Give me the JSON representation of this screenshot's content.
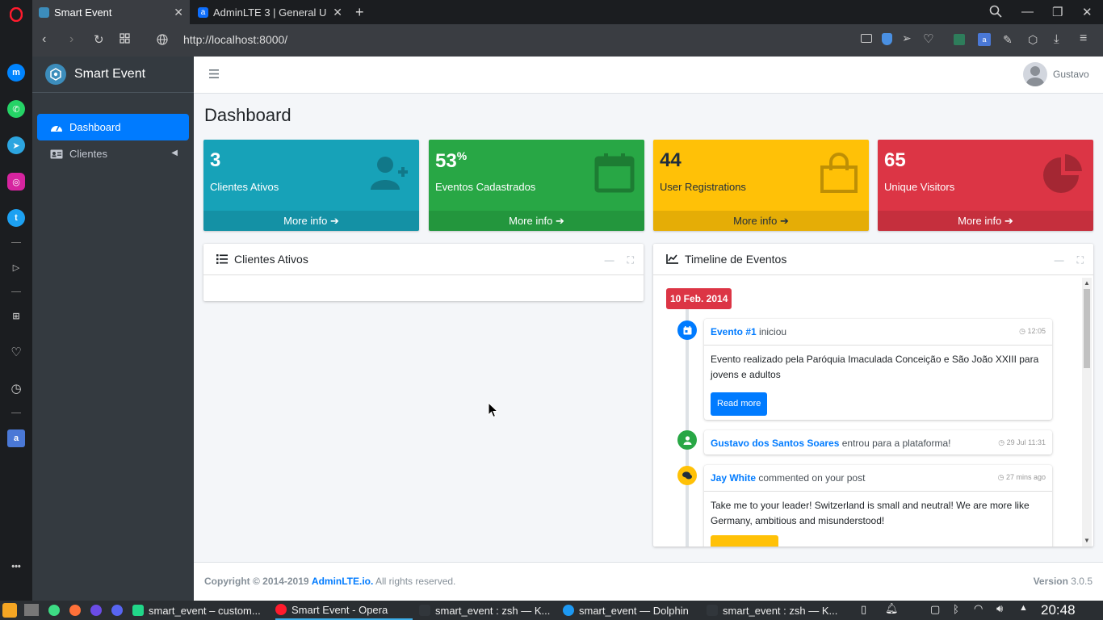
{
  "browser": {
    "tabs": [
      {
        "title": "Smart Event",
        "active": true
      },
      {
        "title": "AdminLTE 3 | General U",
        "active": false
      }
    ],
    "new_tab_label": "+",
    "url": "http://localhost:8000/",
    "accent_color": "#ff1b2d"
  },
  "sidebar": {
    "brand": "Smart Event",
    "items": [
      {
        "label": "Dashboard",
        "icon": "tachometer-icon",
        "active": true
      },
      {
        "label": "Clientes",
        "icon": "address-card-icon",
        "active": false
      }
    ]
  },
  "header": {
    "user_name": "Gustavo"
  },
  "main": {
    "title": "Dashboard",
    "boxes": [
      {
        "value": "3",
        "suffix": "",
        "label": "Clientes Ativos",
        "footer": "More info",
        "color": "#17a2b8",
        "icon": "user-plus-icon"
      },
      {
        "value": "53",
        "suffix": "%",
        "label": "Eventos Cadastrados",
        "footer": "More info",
        "color": "#28a745",
        "icon": "calendar-icon"
      },
      {
        "value": "44",
        "suffix": "",
        "label": "User Registrations",
        "footer": "More info",
        "color": "#ffc107",
        "icon": "shopping-bag-icon"
      },
      {
        "value": "65",
        "suffix": "",
        "label": "Unique Visitors",
        "footer": "More info",
        "color": "#dc3545",
        "icon": "pie-chart-icon"
      }
    ],
    "clients_card": {
      "title": "Clientes Ativos"
    },
    "timeline_card": {
      "title": "Timeline de Eventos",
      "date_label": "10 Feb. 2014",
      "items": [
        {
          "actor": "Evento #1",
          "action": "iniciou",
          "time": "12:05",
          "body": "Evento realizado pela Paróquia Imaculada Conceição e São João XXIII para jovens e adultos",
          "button": "Read more"
        },
        {
          "actor": "Gustavo dos Santos Soares",
          "action": "entrou para a plataforma!",
          "time": "29 Jul 11:31"
        },
        {
          "actor": "Jay White",
          "action": "commented on your post",
          "time": "27 mins ago",
          "body": "Take me to your leader! Switzerland is small and neutral! We are more like Germany, ambitious and misunderstood!"
        }
      ]
    }
  },
  "footer": {
    "copyright_prefix": "Copyright © 2014-2019",
    "copyright_link": "AdminLTE.io.",
    "copyright_suffix": "All rights reserved.",
    "version_label": "Version",
    "version_value": "3.0.5"
  },
  "taskbar": {
    "tasks": [
      "smart_event – custom...",
      "Smart Event - Opera",
      "smart_event : zsh — K...",
      "smart_event — Dolphin",
      "smart_event : zsh — K..."
    ],
    "clock": "20:48"
  }
}
